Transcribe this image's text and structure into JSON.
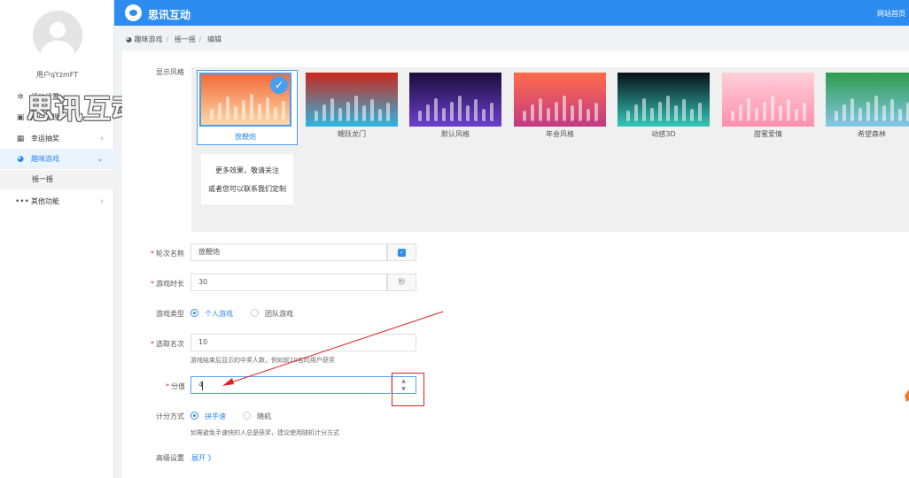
{
  "sidebar": {
    "username": "用户qYzmFT",
    "items": [
      {
        "label": "活动设置",
        "icon": "gear-icon"
      },
      {
        "label": "用户管理",
        "icon": "user-lock-icon"
      },
      {
        "label": "幸运抽奖",
        "icon": "grid-icon"
      },
      {
        "label": "趣味游戏",
        "icon": "pie-icon",
        "active": true
      },
      {
        "label": "其他功能",
        "icon": "dots-icon"
      }
    ],
    "sub_item": "摇一摇"
  },
  "watermark": "思讯互动",
  "topbar": {
    "title": "思讯互动",
    "home_link": "网站首页",
    "accent": "#2d8cf0"
  },
  "breadcrumb": [
    "趣味游戏",
    "摇一摇",
    "编辑"
  ],
  "form": {
    "style_label": "显示风格",
    "styles": [
      {
        "name": "放鞭炮",
        "selected": true,
        "colors": [
          "#f26b3a",
          "#ffd9a8"
        ]
      },
      {
        "name": "鲤跃龙门",
        "colors": [
          "#c9271b",
          "#2fb6e0"
        ]
      },
      {
        "name": "默认风格",
        "colors": [
          "#1a0d3a",
          "#6d3fd0"
        ]
      },
      {
        "name": "年会风格",
        "colors": [
          "#ff6c4a",
          "#c13a83"
        ]
      },
      {
        "name": "动感3D",
        "colors": [
          "#080e18",
          "#36c9b9"
        ]
      },
      {
        "name": "甜蜜爱情",
        "colors": [
          "#ffd0d8",
          "#ff8fae"
        ]
      },
      {
        "name": "希望森林",
        "colors": [
          "#2c9c4b",
          "#86c7e8"
        ]
      }
    ],
    "more_card": {
      "line1": "更多效果，敬请关注",
      "line2": "或者您可以联系我们定制"
    },
    "round_name": {
      "label": "轮次名称",
      "value": "放鞭炮"
    },
    "duration": {
      "label": "游戏时长",
      "value": "30",
      "unit": "秒"
    },
    "game_type": {
      "label": "游戏类型",
      "options": [
        "个人游戏",
        "团队游戏"
      ],
      "selected": "个人游戏"
    },
    "winners": {
      "label": "选取名次",
      "value": "10",
      "hint": "游戏结束后显示的中奖人数，例如前10名的用户获奖"
    },
    "score": {
      "label": "分值",
      "value": "4"
    },
    "scoring": {
      "label": "计分方式",
      "options": [
        "拼手速",
        "随机"
      ],
      "selected": "拼手速",
      "hint": "如需避免手速快的人总是获奖，建议使用随机计分方式"
    },
    "advanced": {
      "label": "高级设置",
      "expand": "展开 》"
    }
  }
}
